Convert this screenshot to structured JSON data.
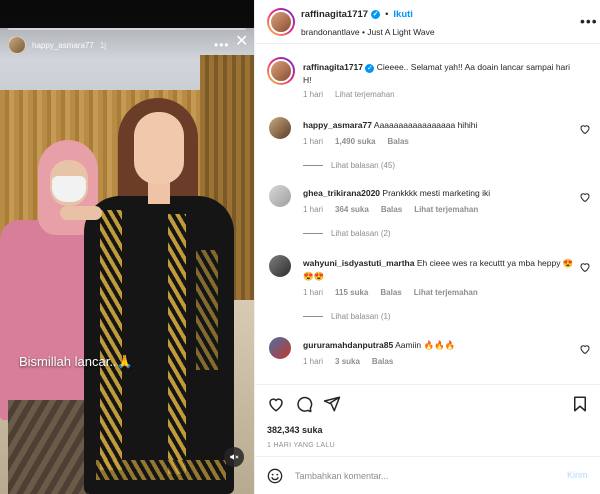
{
  "media": {
    "username": "happy_asmara77",
    "time": "1j",
    "caption": "Bismillah lancar..🙏",
    "icons": {
      "more": "more-horizontal-icon",
      "close": "close-icon",
      "mute": "speaker-muted-icon"
    }
  },
  "header": {
    "username": "raffinagita1717",
    "follow": "Ikuti",
    "subtitle": "brandonantlave • Just A Light Wave",
    "more": "•••"
  },
  "comments": [
    {
      "username": "raffinagita1717",
      "text": "Cieeee.. Selamat yah!! Aa doain lancar sampai hari H!",
      "time": "1 hari",
      "translate": "Lihat terjemahan",
      "verified": true
    },
    {
      "username": "happy_asmara77",
      "text": "Aaaaaaaaaaaaaaaaa hihihi",
      "time": "1 hari",
      "likes": "1,490 suka",
      "reply": "Balas",
      "replies": "Lihat balasan (45)"
    },
    {
      "username": "ghea_trikirana2020",
      "text": "Prankkkk mesti marketing iki",
      "time": "1 hari",
      "likes": "364 suka",
      "reply": "Balas",
      "translate": "Lihat terjemahan",
      "replies": "Lihat balasan (2)"
    },
    {
      "username": "wahyuni_isdyastuti_martha",
      "text": "Eh cieee wes ra kecuttt ya mba heppy 😍😍😍",
      "time": "1 hari",
      "likes": "115 suka",
      "reply": "Balas",
      "translate": "Lihat terjemahan",
      "replies": "Lihat balasan (1)"
    },
    {
      "username": "gururamahdanputra85",
      "text": "Aamiin 🔥🔥🔥",
      "time": "1 hari",
      "likes": "3 suka",
      "reply": "Balas"
    }
  ],
  "actions": {
    "likes": "382,343 suka",
    "ago": "1 HARI YANG LALU",
    "icons": [
      "heart-icon",
      "comment-icon",
      "share-icon",
      "bookmark-icon"
    ]
  },
  "add_comment": {
    "placeholder": "Tambahkan komentar...",
    "post": "Kirim"
  },
  "colors": {
    "accent": "#0095f6",
    "muted": "#8e8e8e",
    "post_disabled": "#b3dbff"
  }
}
